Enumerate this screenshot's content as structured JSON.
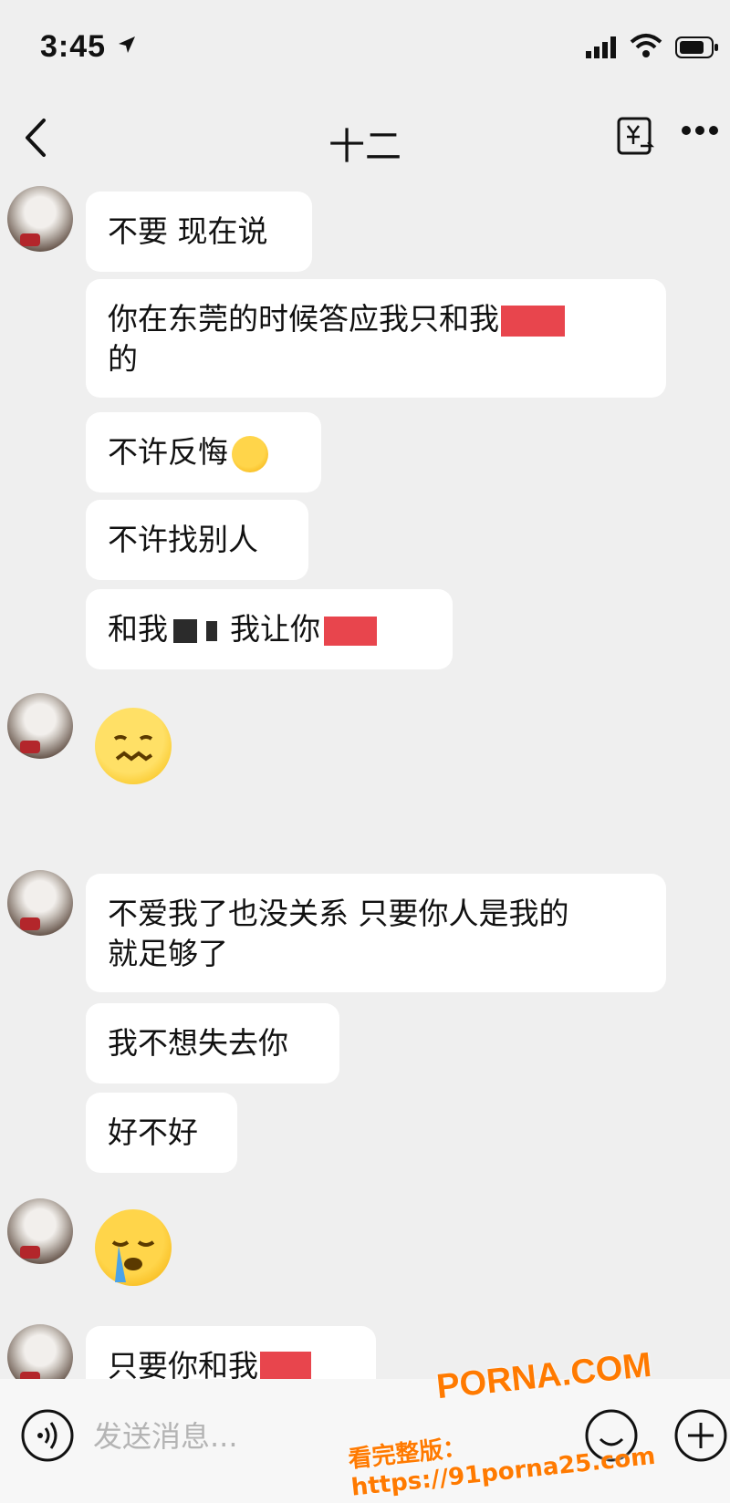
{
  "status_bar": {
    "time": "3:45",
    "icons": [
      "location-arrow-icon",
      "signal-icon",
      "wifi-icon",
      "battery-icon"
    ]
  },
  "header": {
    "title": "十二",
    "back_icon": "chevron-left-icon",
    "translate_icon": "translate-icon",
    "more_icon": "more-dots-icon"
  },
  "messages": [
    {
      "type": "text",
      "text": "不要 现在说"
    },
    {
      "type": "text",
      "lines": [
        "你在东莞的时候答应我只和我",
        "的"
      ],
      "redacted": true
    },
    {
      "type": "text",
      "text": "不许反悔",
      "emoji": "pleading-face"
    },
    {
      "type": "text",
      "text": "不许找别人"
    },
    {
      "type": "text",
      "parts": [
        "和我",
        "我让你"
      ],
      "redacted": true
    },
    {
      "type": "emoji",
      "emoji": "woozy-face"
    },
    {
      "type": "text",
      "lines": [
        "不爱我了也没关系 只要你人是我的",
        "就足够了"
      ]
    },
    {
      "type": "text",
      "text": "我不想失去你"
    },
    {
      "type": "text",
      "text": "好不好"
    },
    {
      "type": "emoji",
      "emoji": "loudly-crying-face"
    },
    {
      "type": "text",
      "text": "只要你和我",
      "redacted": true
    }
  ],
  "input_bar": {
    "placeholder": "发送消息...",
    "voice_icon": "voice-icon",
    "emoji_icon": "smiley-icon",
    "plus_icon": "plus-icon"
  },
  "watermark": {
    "site": "PORNA.COM",
    "url_text": "看完整版：https://91porna25.com"
  },
  "colors": {
    "background": "#efefef",
    "bubble": "#ffffff",
    "redaction": "#e8454d",
    "watermark": "#ff7a00"
  }
}
